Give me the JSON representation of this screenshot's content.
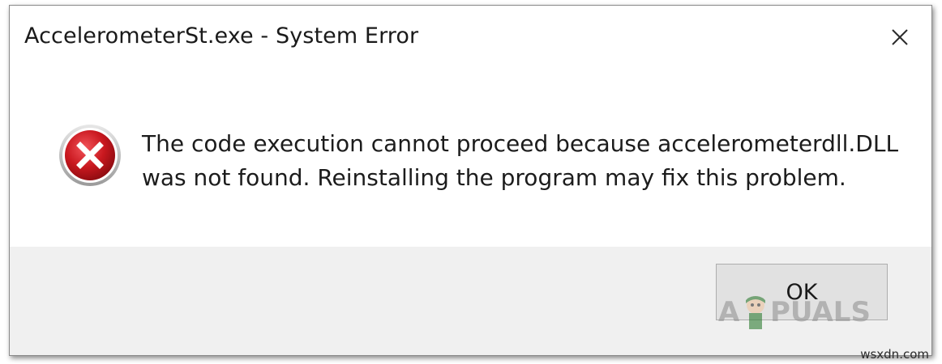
{
  "window": {
    "title": "AccelerometerSt.exe - System Error"
  },
  "message": {
    "line1": "The code execution cannot proceed because accelerometerdll.DLL",
    "line2": "was not found. Reinstalling the program may fix this problem."
  },
  "buttons": {
    "ok_label": "OK"
  },
  "icons": {
    "error": "error-icon",
    "close": "close-icon"
  },
  "colors": {
    "error_red": "#c1121f",
    "footer_bg": "#f0f0f0",
    "button_bg": "#e1e1e1"
  },
  "watermarks": {
    "logo_text": "APPUALS",
    "site": "wsxdn.com"
  }
}
